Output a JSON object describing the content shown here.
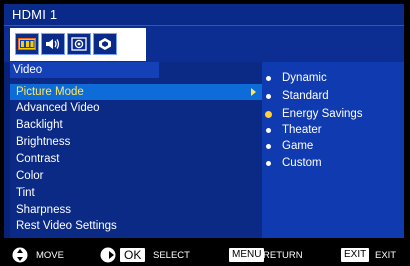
{
  "title": "HDMI 1",
  "icons": [
    "picture-icon",
    "sound-icon",
    "setup-icon",
    "settings-icon"
  ],
  "section": "Video",
  "menu_items": [
    {
      "label": "Picture Mode",
      "selected": true
    },
    {
      "label": "Advanced Video"
    },
    {
      "label": "Backlight"
    },
    {
      "label": "Brightness"
    },
    {
      "label": "Contrast"
    },
    {
      "label": "Color"
    },
    {
      "label": "Tint"
    },
    {
      "label": "Sharpness"
    },
    {
      "label": "Rest Video Settings"
    }
  ],
  "options": [
    {
      "label": "Dynamic"
    },
    {
      "label": "Standard"
    },
    {
      "label": "Energy Savings",
      "selected": true
    },
    {
      "label": "Theater"
    },
    {
      "label": "Game"
    },
    {
      "label": "Custom"
    }
  ],
  "footer": {
    "move": "MOVE",
    "ok_key": "OK",
    "select": "SELECT",
    "menu_key": "MENU",
    "return": "RETURN",
    "exit_key": "EXIT",
    "exit": "EXIT"
  },
  "colors": {
    "selected_text": "#ffe766",
    "selected_row": "#0d6cd8",
    "panel": "#0b2a86"
  }
}
